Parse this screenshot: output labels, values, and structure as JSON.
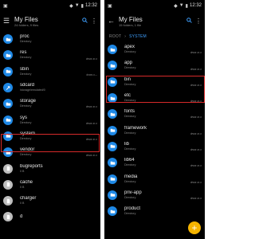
{
  "colors": {
    "accent": "#3fa0ff",
    "folder": "#1e88e5",
    "link": "#1e88e5",
    "file": "#bdbdbd",
    "highlight": "#d62a2a",
    "fab": "#f5b400"
  },
  "left": {
    "statusbar": {
      "time": "12:32"
    },
    "appbar": {
      "title": "My Files",
      "subtitle": "24 folders, 9 files"
    },
    "items": [
      {
        "name": "proc",
        "sub": "Directory",
        "perm": "",
        "type": "folder"
      },
      {
        "name": "res",
        "sub": "Directory",
        "perm": "drwxr-xr-x",
        "type": "folder"
      },
      {
        "name": "sbin",
        "sub": "Directory",
        "perm": "drwxr-x---",
        "type": "folder"
      },
      {
        "name": "sdcard",
        "sub": "/storage/emulated/0",
        "perm": "",
        "type": "link"
      },
      {
        "name": "storage",
        "sub": "Directory",
        "perm": "drwxr-xr-x",
        "type": "folder"
      },
      {
        "name": "sys",
        "sub": "Directory",
        "perm": "drwxr-xr-x",
        "type": "folder"
      },
      {
        "name": "system",
        "sub": "Directory",
        "perm": "drwxr-xr-x",
        "type": "folder"
      },
      {
        "name": "vendor",
        "sub": "Directory",
        "perm": "drwxr-xr-x",
        "type": "folder"
      },
      {
        "name": "bugreports",
        "sub": "0 B",
        "perm": "",
        "type": "file"
      },
      {
        "name": "cache",
        "sub": "0 B",
        "perm": "",
        "type": "file"
      },
      {
        "name": "charger",
        "sub": "0 B",
        "perm": "",
        "type": "file"
      },
      {
        "name": "d",
        "sub": "",
        "perm": "",
        "type": "file"
      }
    ]
  },
  "right": {
    "statusbar": {
      "time": "12:32"
    },
    "appbar": {
      "title": "My Files",
      "subtitle": "15 folders, 1 file"
    },
    "breadcrumb": {
      "root": "ROOT",
      "current": "SYSTEM"
    },
    "items": [
      {
        "name": "apex",
        "sub": "Directory",
        "perm": "drwxr-xr-x",
        "type": "folder"
      },
      {
        "name": "app",
        "sub": "Directory",
        "perm": "drwxr-xr-x",
        "type": "folder"
      },
      {
        "name": "bin",
        "sub": "Directory",
        "perm": "drwxr-xr-x",
        "type": "folder"
      },
      {
        "name": "etc",
        "sub": "Directory",
        "perm": "drwxr-xr-x",
        "type": "folder"
      },
      {
        "name": "fonts",
        "sub": "Directory",
        "perm": "drwxr-xr-x",
        "type": "folder"
      },
      {
        "name": "framework",
        "sub": "Directory",
        "perm": "drwxr-xr-x",
        "type": "folder"
      },
      {
        "name": "lib",
        "sub": "Directory",
        "perm": "drwxr-xr-x",
        "type": "folder"
      },
      {
        "name": "lib64",
        "sub": "Directory",
        "perm": "drwxr-xr-x",
        "type": "folder"
      },
      {
        "name": "media",
        "sub": "Directory",
        "perm": "drwxr-xr-x",
        "type": "folder"
      },
      {
        "name": "priv-app",
        "sub": "Directory",
        "perm": "drwxr-xr-x",
        "type": "folder"
      },
      {
        "name": "product",
        "sub": "Directory",
        "perm": "",
        "type": "folder"
      }
    ],
    "fab": {
      "label": "+"
    }
  }
}
